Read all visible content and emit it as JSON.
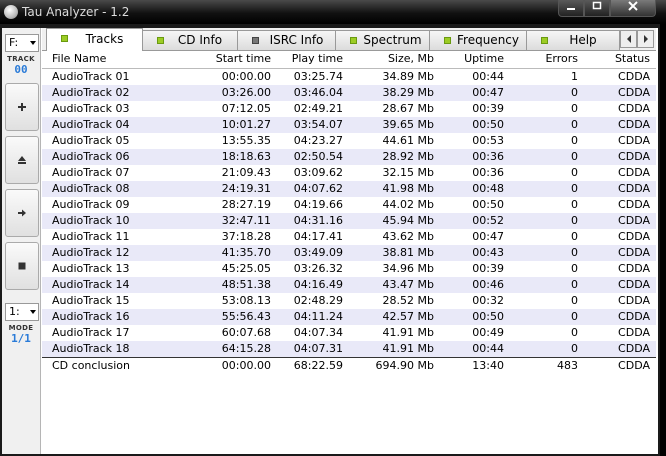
{
  "window": {
    "title": "Tau Analyzer - 1.2"
  },
  "left_panel": {
    "drive_value": "F:",
    "track_label": "TRACK",
    "track_value": "00",
    "mode_value": "1:",
    "mode_label": "MODE",
    "mode_display": "1/1"
  },
  "tabs": [
    {
      "label": "Tracks",
      "active": true,
      "led": "green"
    },
    {
      "label": "CD Info",
      "active": false,
      "led": "green"
    },
    {
      "label": "ISRC Info",
      "active": false,
      "led": "gray"
    },
    {
      "label": "Spectrum",
      "active": false,
      "led": "green"
    },
    {
      "label": "Frequency",
      "active": false,
      "led": "green"
    },
    {
      "label": "Help",
      "active": false,
      "led": "green"
    }
  ],
  "table": {
    "headers": {
      "name": "File Name",
      "start": "Start time",
      "play": "Play time",
      "size": "Size, Mb",
      "uptime": "Uptime",
      "errors": "Errors",
      "status": "Status"
    },
    "rows": [
      {
        "name": "AudioTrack 01",
        "start": "00:00.00",
        "play": "03:25.74",
        "size": "34.89 Mb",
        "uptime": "00:44",
        "errors": "1",
        "status": "CDDA"
      },
      {
        "name": "AudioTrack 02",
        "start": "03:26.00",
        "play": "03:46.04",
        "size": "38.29 Mb",
        "uptime": "00:47",
        "errors": "0",
        "status": "CDDA"
      },
      {
        "name": "AudioTrack 03",
        "start": "07:12.05",
        "play": "02:49.21",
        "size": "28.67 Mb",
        "uptime": "00:39",
        "errors": "0",
        "status": "CDDA"
      },
      {
        "name": "AudioTrack 04",
        "start": "10:01.27",
        "play": "03:54.07",
        "size": "39.65 Mb",
        "uptime": "00:50",
        "errors": "0",
        "status": "CDDA"
      },
      {
        "name": "AudioTrack 05",
        "start": "13:55.35",
        "play": "04:23.27",
        "size": "44.61 Mb",
        "uptime": "00:53",
        "errors": "0",
        "status": "CDDA"
      },
      {
        "name": "AudioTrack 06",
        "start": "18:18.63",
        "play": "02:50.54",
        "size": "28.92 Mb",
        "uptime": "00:36",
        "errors": "0",
        "status": "CDDA"
      },
      {
        "name": "AudioTrack 07",
        "start": "21:09.43",
        "play": "03:09.62",
        "size": "32.15 Mb",
        "uptime": "00:36",
        "errors": "0",
        "status": "CDDA"
      },
      {
        "name": "AudioTrack 08",
        "start": "24:19.31",
        "play": "04:07.62",
        "size": "41.98 Mb",
        "uptime": "00:48",
        "errors": "0",
        "status": "CDDA"
      },
      {
        "name": "AudioTrack 09",
        "start": "28:27.19",
        "play": "04:19.66",
        "size": "44.02 Mb",
        "uptime": "00:50",
        "errors": "0",
        "status": "CDDA"
      },
      {
        "name": "AudioTrack 10",
        "start": "32:47.11",
        "play": "04:31.16",
        "size": "45.94 Mb",
        "uptime": "00:52",
        "errors": "0",
        "status": "CDDA"
      },
      {
        "name": "AudioTrack 11",
        "start": "37:18.28",
        "play": "04:17.41",
        "size": "43.62 Mb",
        "uptime": "00:47",
        "errors": "0",
        "status": "CDDA"
      },
      {
        "name": "AudioTrack 12",
        "start": "41:35.70",
        "play": "03:49.09",
        "size": "38.81 Mb",
        "uptime": "00:43",
        "errors": "0",
        "status": "CDDA"
      },
      {
        "name": "AudioTrack 13",
        "start": "45:25.05",
        "play": "03:26.32",
        "size": "34.96 Mb",
        "uptime": "00:39",
        "errors": "0",
        "status": "CDDA"
      },
      {
        "name": "AudioTrack 14",
        "start": "48:51.38",
        "play": "04:16.49",
        "size": "43.47 Mb",
        "uptime": "00:46",
        "errors": "0",
        "status": "CDDA"
      },
      {
        "name": "AudioTrack 15",
        "start": "53:08.13",
        "play": "02:48.29",
        "size": "28.52 Mb",
        "uptime": "00:32",
        "errors": "0",
        "status": "CDDA"
      },
      {
        "name": "AudioTrack 16",
        "start": "55:56.43",
        "play": "04:11.24",
        "size": "42.57 Mb",
        "uptime": "00:50",
        "errors": "0",
        "status": "CDDA"
      },
      {
        "name": "AudioTrack 17",
        "start": "60:07.68",
        "play": "04:07.34",
        "size": "41.91 Mb",
        "uptime": "00:49",
        "errors": "0",
        "status": "CDDA"
      },
      {
        "name": "AudioTrack 18",
        "start": "64:15.28",
        "play": "04:07.31",
        "size": "41.91 Mb",
        "uptime": "00:44",
        "errors": "0",
        "status": "CDDA"
      }
    ],
    "summary": {
      "name": "CD conclusion",
      "start": "00:00.00",
      "play": "68:22.59",
      "size": "694.90 Mb",
      "uptime": "13:40",
      "errors": "483",
      "status": "CDDA"
    }
  },
  "colors": {
    "led_green": "#9ccc24",
    "row_alt": "#e9e9f8",
    "accent_blue": "#2a7bd8"
  }
}
